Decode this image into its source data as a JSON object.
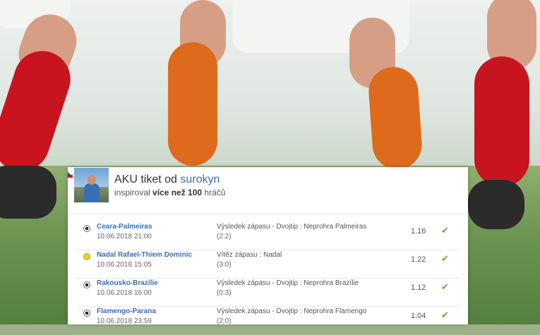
{
  "ticket": {
    "title_prefix": "AKU tiket od ",
    "username": "surokyn",
    "subtitle_prefix": "inspiroval ",
    "subtitle_bold": "více než 100",
    "subtitle_suffix": " hráčů",
    "flag_icon": "czech-flag-icon",
    "colors": {
      "accent": "#3b6eb5",
      "win": "#5cae3a"
    }
  },
  "bets": [
    {
      "sport_icon": "football-icon",
      "match": "Ceara-Palmeiras",
      "datetime": "10.06.2018 21:00",
      "bet": "Výsledek zápasu - Dvojtip : Neprohra Palmeiras",
      "score": "(2:2)",
      "odds": "1.16",
      "status": "win-check-icon"
    },
    {
      "sport_icon": "tennis-icon",
      "match": "Nadal Rafael-Thiem Dominic",
      "datetime": "10.06.2018 15:05",
      "bet": "Vítěz zápasu : Nadal",
      "score": "(3:0)",
      "odds": "1.22",
      "status": "win-check-icon"
    },
    {
      "sport_icon": "football-icon",
      "match": "Rakousko-Brazílie",
      "datetime": "10.06.2018 16:00",
      "bet": "Výsledek zápasu - Dvojtip : Neprohra Brazílie",
      "score": "(0:3)",
      "odds": "1.12",
      "status": "win-check-icon"
    },
    {
      "sport_icon": "football-icon",
      "match": "Flamengo-Parana",
      "datetime": "10.06.2018 23:59",
      "bet": "Výsledek zápasu - Dvojtip : Neprohra Flamengo",
      "score": "(2:0)",
      "odds": "1.04",
      "status": "win-check-icon"
    }
  ]
}
